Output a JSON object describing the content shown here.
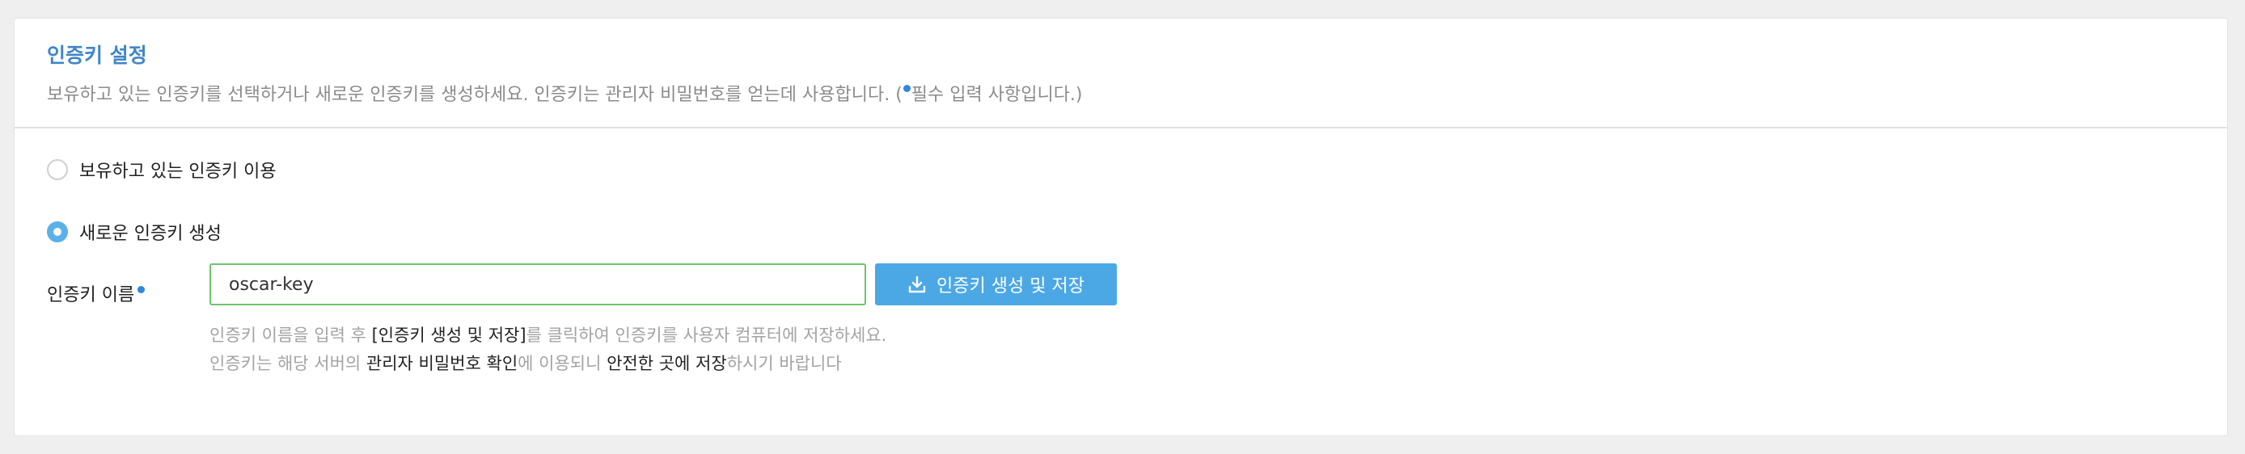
{
  "header": {
    "title": "인증키 설정",
    "desc_before": "보유하고 있는 인증키를 선택하거나 새로운 인증키를 생성하세요. 인증키는 관리자 비밀번호를 얻는데 사용합니다. (",
    "desc_after": "필수 입력 사항입니다.)"
  },
  "options": {
    "existing_label": "보유하고 있는 인증키 이용",
    "existing_checked": false,
    "new_label": "새로운 인증키 생성",
    "new_checked": true
  },
  "form": {
    "name_label": "인증키 이름",
    "name_value": "oscar-key",
    "button_label": "인증키 생성 및 저장"
  },
  "help": {
    "line1_a": "인증키 이름을 입력 후 ",
    "line1_b": "[인증키 생성 및 저장]",
    "line1_c": "를 클릭하여 인증키를 사용자 컴퓨터에 저장하세요.",
    "line2_a": "인증키는 해당 서버의 ",
    "line2_b": "관리자 비밀번호 확인",
    "line2_c": "에 이용되니 ",
    "line2_d": "안전한 곳에 저장",
    "line2_e": "하시기 바랍니다"
  },
  "icons": {
    "button_icon": "download-icon",
    "required_marker": "required-dot"
  },
  "colors": {
    "title": "#3f86c9",
    "required_dot": "#2f86db",
    "button": "#4ba8e5",
    "radio_checked": "#5bb0e8",
    "input_border": "#6fc36b"
  }
}
